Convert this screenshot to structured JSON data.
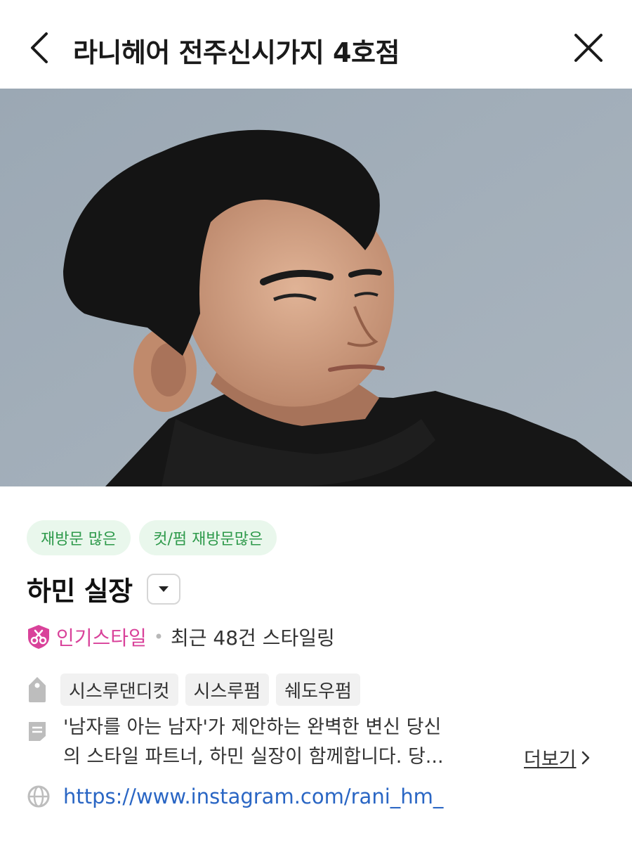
{
  "header": {
    "title": "라니헤어 전주신시가지 4호점"
  },
  "badges": [
    "재방문 많은",
    "컷/펌 재방문많은"
  ],
  "designer": {
    "name": "하민 실장",
    "popular_label": "인기스타일",
    "recent_styling": "최근 48건 스타일링"
  },
  "tags": [
    "시스루댄디컷",
    "시스루펌",
    "쉐도우펌"
  ],
  "description": {
    "line1": "'남자를 아는 남자'가 제안하는 완벽한 변신 당신",
    "line2": "의 스타일 파트너, 하민 실장이 함께합니다. 당...",
    "more_label": "더보기"
  },
  "link": {
    "url": "https://www.instagram.com/rani_hm_"
  },
  "colors": {
    "badge_bg": "#e9f7ec",
    "badge_text": "#2e9a4b",
    "popular_pink": "#d9429a",
    "link_blue": "#2a66c4"
  }
}
